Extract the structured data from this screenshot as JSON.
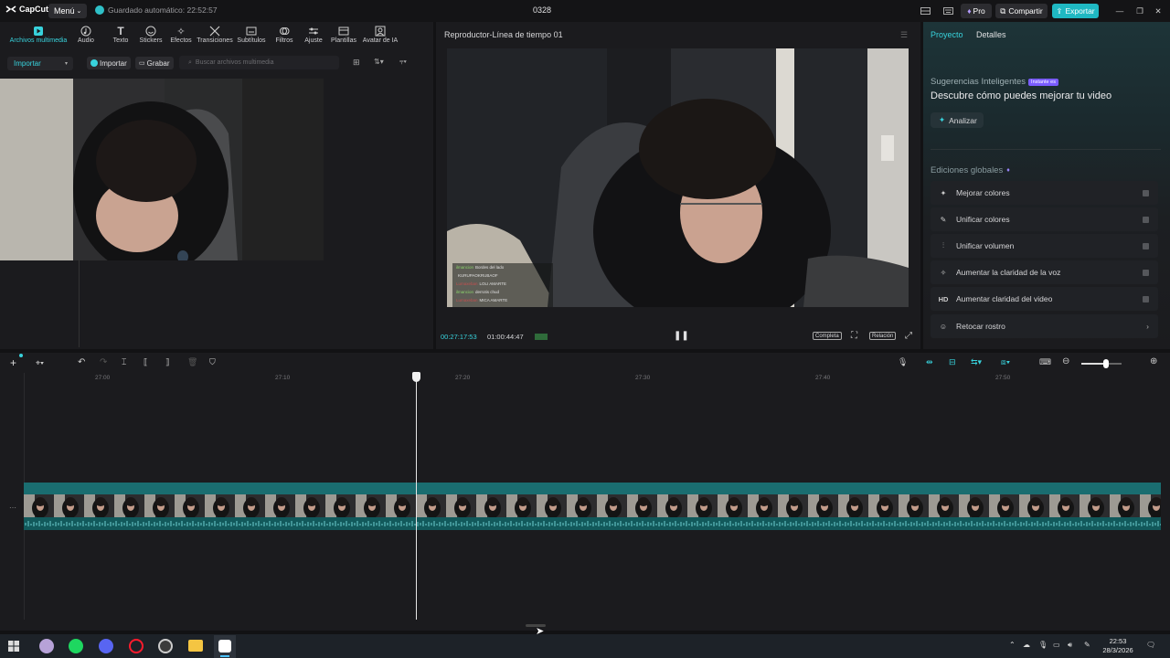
{
  "titlebar": {
    "app_name": "CapCut",
    "menu_label": "Menú",
    "autosave_text": "Guardado automático: 22:52:57",
    "project_name": "0328",
    "pro_label": "Pro",
    "share_label": "Compartir",
    "export_label": "Exportar",
    "accent_color": "#38d3dd"
  },
  "toolbar": {
    "tools": [
      {
        "label": "Archivos multimedia",
        "icon": "media-icon"
      },
      {
        "label": "Audio",
        "icon": "audio-icon"
      },
      {
        "label": "Texto",
        "icon": "text-icon"
      },
      {
        "label": "Stickers",
        "icon": "sticker-icon"
      },
      {
        "label": "Efectos",
        "icon": "effects-icon"
      },
      {
        "label": "Transiciones",
        "icon": "transitions-icon"
      },
      {
        "label": "Subtítulos",
        "icon": "subtitles-icon"
      },
      {
        "label": "Filtros",
        "icon": "filters-icon"
      },
      {
        "label": "Ajuste",
        "icon": "adjust-icon"
      },
      {
        "label": "Plantillas",
        "icon": "templates-icon"
      },
      {
        "label": "Avatar de IA",
        "icon": "avatar-icon"
      }
    ]
  },
  "media": {
    "import_tab": "Importar",
    "import_button": "Importar",
    "record_button": "Grabar",
    "search_placeholder": "Buscar archivos multimedia"
  },
  "player": {
    "title": "Reproductor-Línea de tiempo 01",
    "current_time": "00:27:17:53",
    "total_time": "01:00:44:47",
    "complete_label": "Completa",
    "ratio_label": "Relación",
    "chat": [
      {
        "user": "ilmancion",
        "msg": "Bordes del lado",
        "color": "#8bd36b"
      },
      {
        "user": "",
        "msg": "KURUPAOKRUBAOF",
        "color": "#d6a84b"
      },
      {
        "user": "Lumaxeban",
        "msg": "LOLI AMARTE",
        "color": "#c05050"
      },
      {
        "user": "ilmancion",
        "msg": "derrotis chud",
        "color": "#8bd36b"
      },
      {
        "user": "Lumaxeban",
        "msg": "MICA AMARTE",
        "color": "#c05050"
      }
    ]
  },
  "details": {
    "tab_project": "Proyecto",
    "tab_details": "Detalles",
    "suggestions_title": "Sugerencias Inteligentes",
    "suggestions_badge": "Instante es",
    "suggestions_desc": "Descubre cómo puedes mejorar tu video",
    "analyze_label": "Analizar",
    "global_title": "Ediciones globales",
    "edits": [
      {
        "label": "Mejorar colores",
        "icon": "enhance-colors-icon"
      },
      {
        "label": "Unificar colores",
        "icon": "unify-colors-icon"
      },
      {
        "label": "Unificar volumen",
        "icon": "unify-volume-icon"
      },
      {
        "label": "Aumentar la claridad de la voz",
        "icon": "voice-clarity-icon"
      },
      {
        "label": "Aumentar claridad del video",
        "icon": "hd-icon"
      },
      {
        "label": "Retocar rostro",
        "icon": "retouch-face-icon"
      }
    ]
  },
  "timeline": {
    "ticks": [
      "27:00",
      "27:10",
      "27:20",
      "27:30",
      "27:40",
      "27:50"
    ]
  },
  "taskbar": {
    "time": "22:53",
    "date": "28/3/2026"
  }
}
